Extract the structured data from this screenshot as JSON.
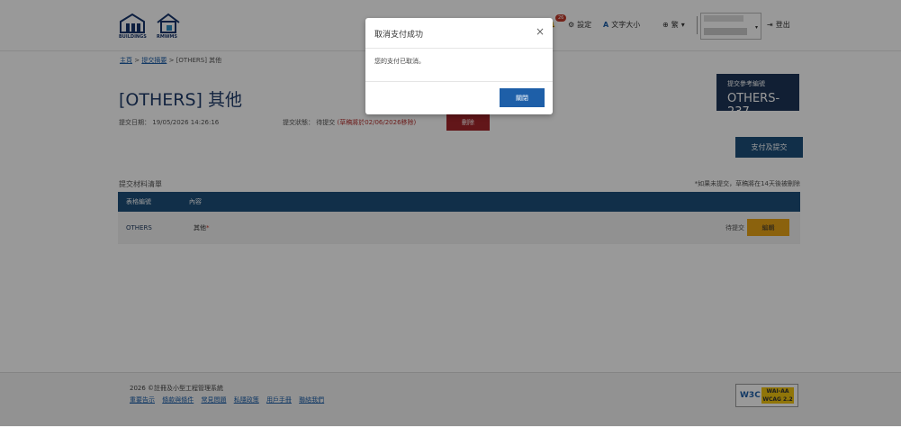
{
  "header": {
    "logo1_caption": "BUILDINGS",
    "logo2_caption": "RMWMS",
    "notification_count": "26",
    "settings_label": "設定",
    "font_size_label": "文字大小",
    "language_label": "繁",
    "logout_label": "登出"
  },
  "breadcrumb": {
    "home": "主頁",
    "sep1": ">",
    "submissions": "提交摘要",
    "sep2": ">",
    "current": "[OTHERS] 其他"
  },
  "page": {
    "title": "[OTHERS] 其他",
    "submit_date_label": "提交日期：",
    "submit_date": "19/05/2026 14:26:16",
    "status_label": "提交狀態：",
    "status_value": "待提交",
    "status_note": "(草稿將於02/06/2026移除)",
    "delete_button": "刪除",
    "ref_label": "提交參考編號",
    "ref_value": "OTHERS-237",
    "pay_submit_button": "支付及提交",
    "materials_title": "提交材料清單",
    "materials_note": "*如果未提交，草稿將在14天後被刪除"
  },
  "table": {
    "headers": [
      "表格編號",
      "內容"
    ],
    "rows": [
      {
        "form_no": "OTHERS",
        "content": "其他",
        "required_mark": "*",
        "status": "待提交",
        "edit_button": "編輯"
      }
    ]
  },
  "footer": {
    "line1": "2026 ©註冊及小型工程管理系統",
    "links": [
      "重要告示",
      "條款與條件",
      "常見問題",
      "私隱政策",
      "用戶手冊",
      "聯絡我們"
    ],
    "badge_w3c": "W3C",
    "badge_text1": "WAI-AA",
    "badge_text2": "WCAG 2.2"
  },
  "modal": {
    "title": "取消支付成功",
    "close_symbol": "×",
    "message": "您的支付已取消。",
    "close_button": "關閉"
  }
}
